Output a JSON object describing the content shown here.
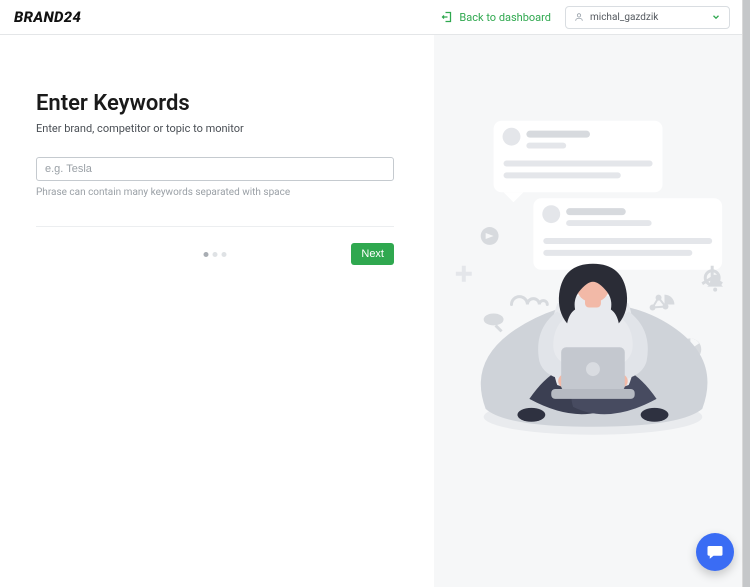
{
  "header": {
    "brand": "BRAND24",
    "back_label": "Back to dashboard",
    "username": "michal_gazdzik"
  },
  "main": {
    "title": "Enter Keywords",
    "subtitle": "Enter brand, competitor or topic to monitor",
    "keyword_placeholder": "e.g. Tesla",
    "keyword_value": "",
    "hint": "Phrase can contain many keywords separated with space",
    "next_label": "Next",
    "steps_total": 3,
    "step_active": 1
  },
  "colors": {
    "accent_green": "#2fa84f",
    "chat_blue": "#3a6cf4"
  }
}
